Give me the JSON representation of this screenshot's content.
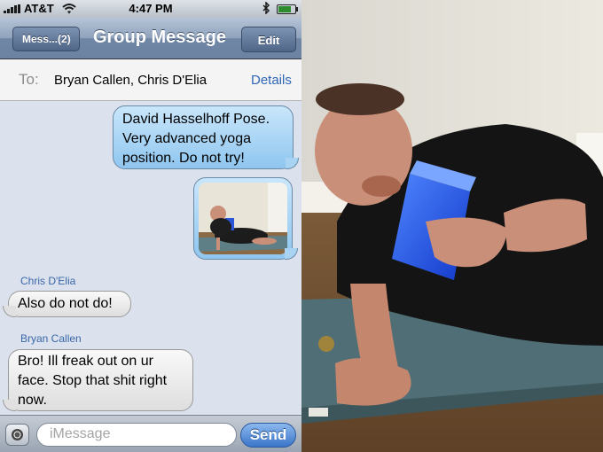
{
  "status_bar": {
    "carrier": "AT&T",
    "time": "4:47 PM",
    "battery_fraction": 0.85
  },
  "nav": {
    "back_label": "Mess...(2)",
    "title": "Group Message",
    "edit_label": "Edit"
  },
  "to_bar": {
    "label": "To:",
    "recipients": "Bryan Callen, Chris D'Elia",
    "details_label": "Details"
  },
  "messages": [
    {
      "direction": "outgoing",
      "lines": [
        "David Hasselhoff Pose.",
        "Very advanced yoga",
        "position. Do not try!"
      ]
    },
    {
      "direction": "outgoing",
      "type": "photo"
    },
    {
      "direction": "incoming",
      "sender": "Chris D'Elia",
      "lines": [
        "Also do not do!"
      ]
    },
    {
      "direction": "incoming",
      "sender": "Bryan Callen",
      "lines": [
        "Bro! Ill freak out on ur",
        "face. Stop that shit right",
        "now."
      ]
    }
  ],
  "compose": {
    "placeholder": "iMessage",
    "send_label": "Send"
  },
  "colors": {
    "nav_blue": "#6d83a2",
    "outgoing_bubble": "#a8d3f3",
    "incoming_bubble": "#e6e6e6",
    "send_blue": "#3a75c8",
    "sender_name": "#3a66a8"
  },
  "icons": [
    "signal-bars-icon",
    "wifi-icon",
    "bluetooth-icon",
    "battery-icon",
    "camera-icon"
  ]
}
